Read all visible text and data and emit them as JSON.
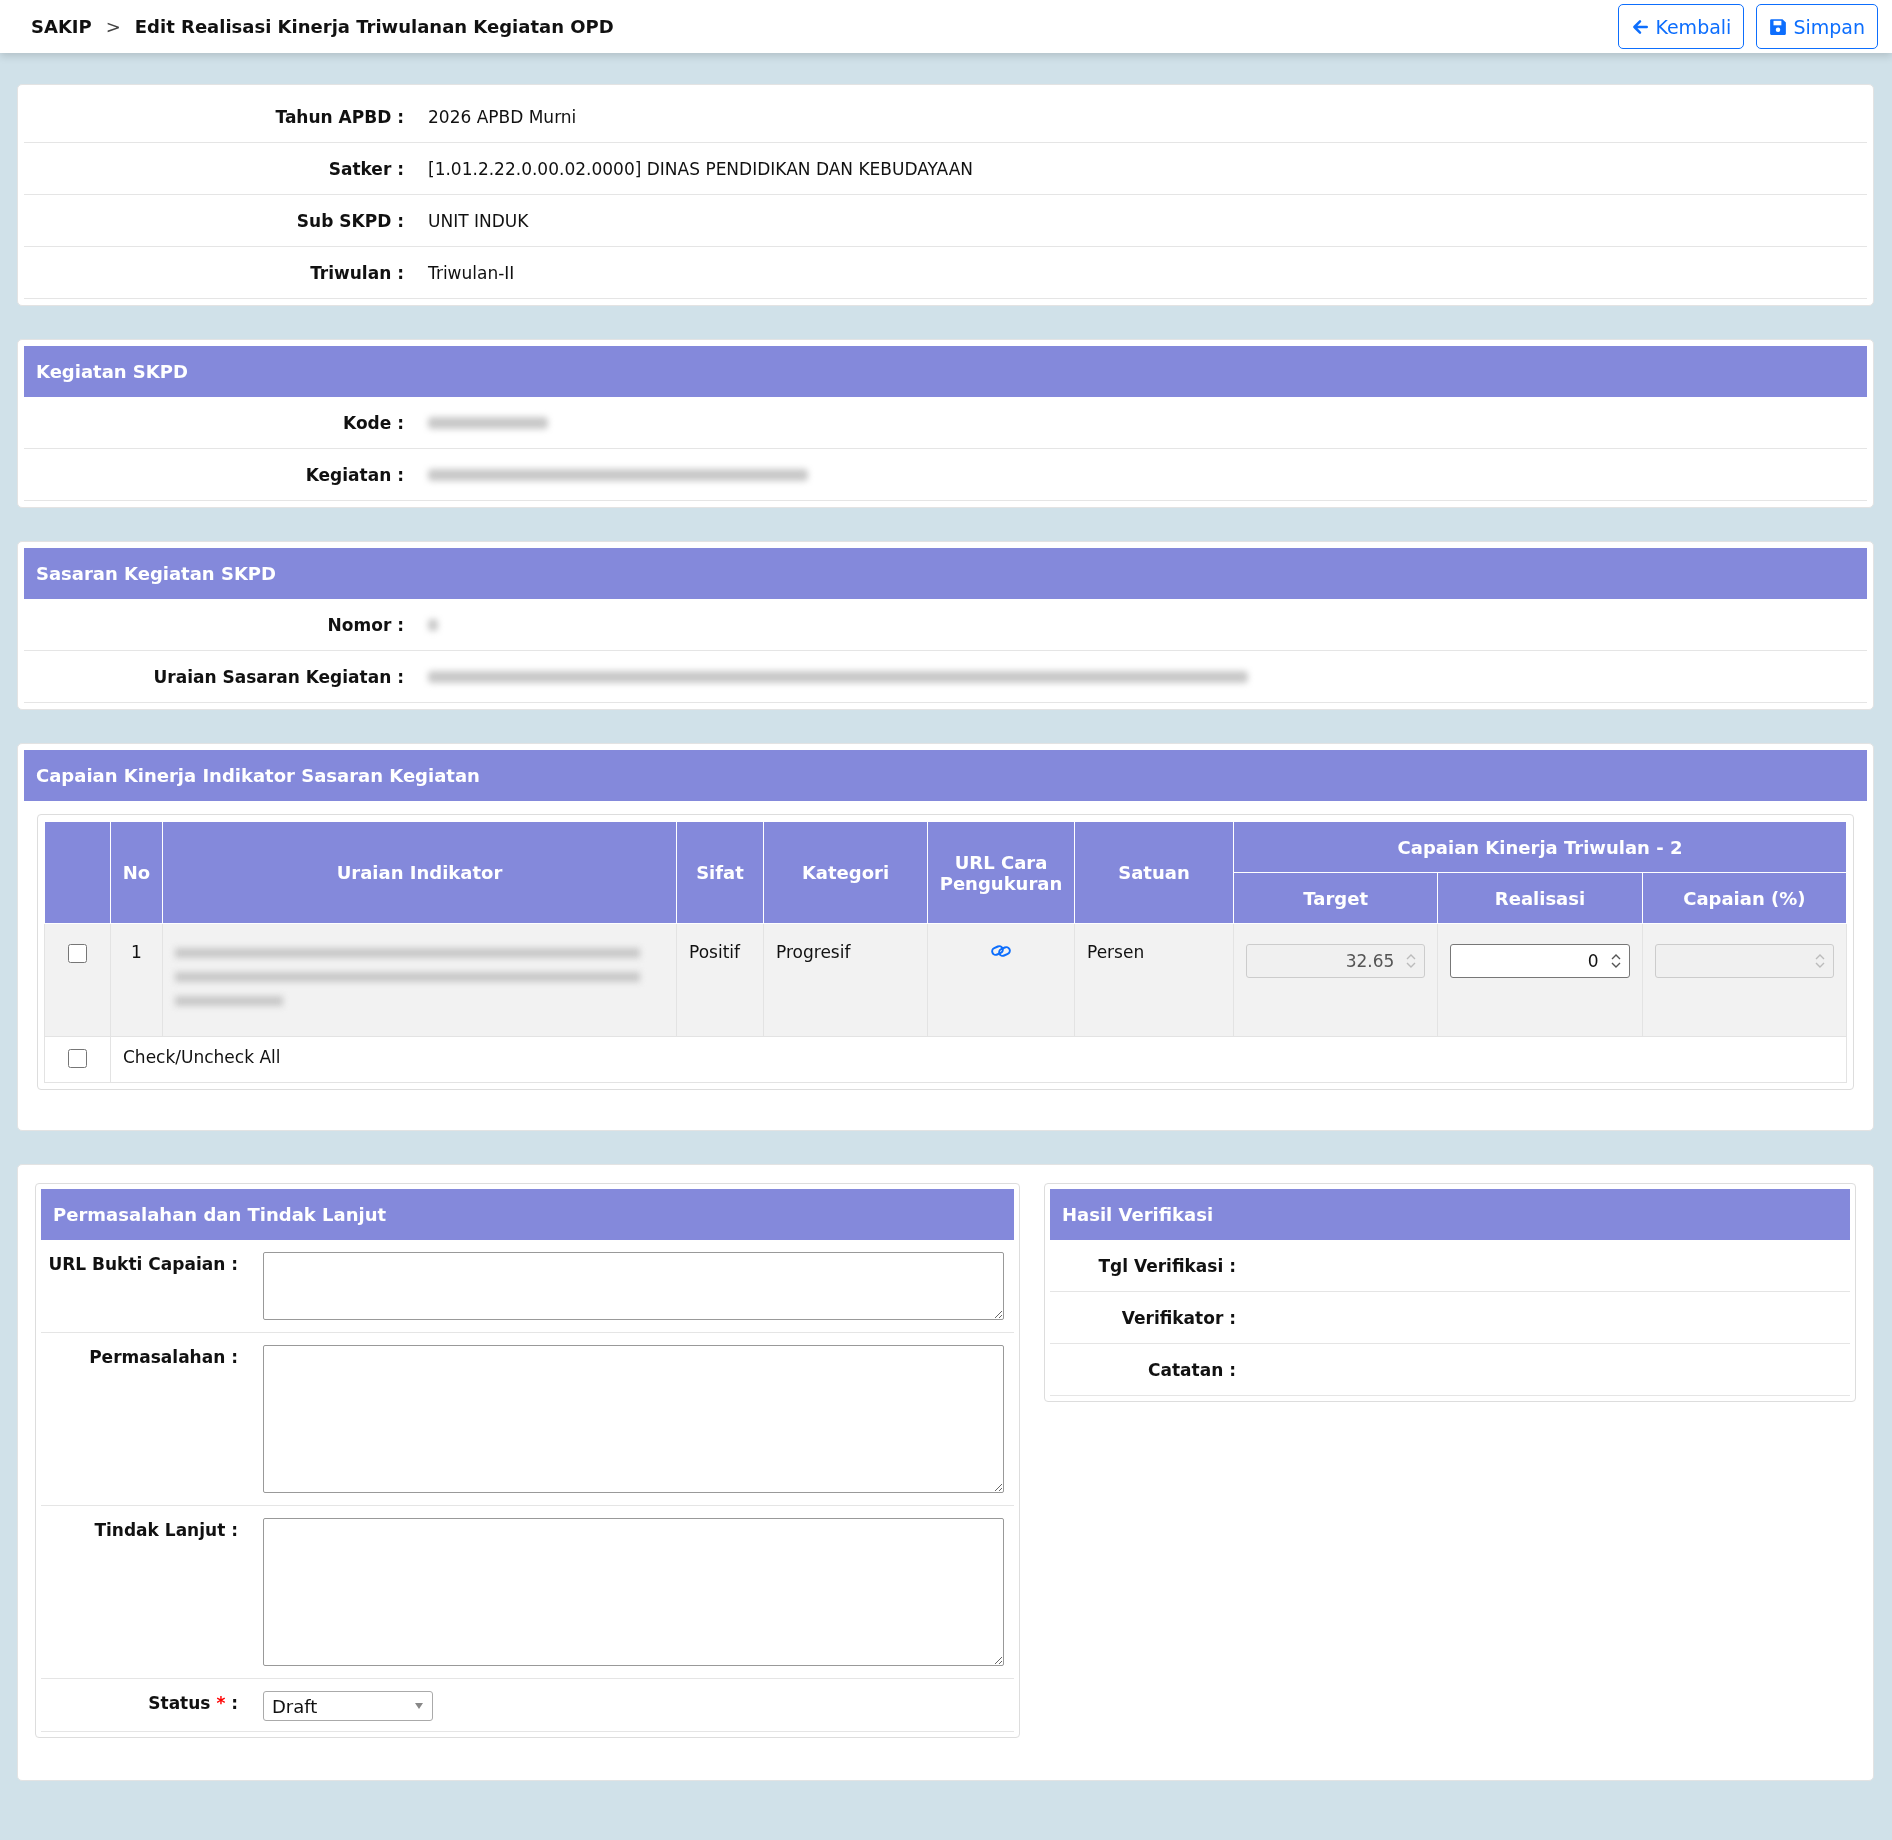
{
  "breadcrumb": {
    "root": "SAKIP",
    "separator": ">",
    "title": "Edit Realisasi Kinerja Triwulanan Kegiatan OPD"
  },
  "actions": [
    {
      "label": "Kembali",
      "kind": "back"
    },
    {
      "label": "Simpan",
      "kind": "save"
    }
  ],
  "info": [
    {
      "label": "Tahun APBD :",
      "value": "2026 APBD Murni"
    },
    {
      "label": "Satker :",
      "value": "[1.01.2.22.0.00.02.0000] DINAS PENDIDIKAN DAN KEBUDAYAAN"
    },
    {
      "label": "Sub SKPD :",
      "value": "UNIT INDUK"
    },
    {
      "label": "Triwulan :",
      "value": "Triwulan-II"
    }
  ],
  "kegiatan": {
    "title": "Kegiatan SKPD",
    "rows": [
      {
        "label": "Kode :",
        "blurred": true
      },
      {
        "label": "Kegiatan :",
        "blurred": true
      }
    ]
  },
  "sasaran": {
    "title": "Sasaran Kegiatan SKPD",
    "rows": [
      {
        "label": "Nomor :",
        "blurred": true
      },
      {
        "label": "Uraian Sasaran Kegiatan :",
        "blurred": true
      }
    ]
  },
  "capaian": {
    "title": "Capaian Kinerja Indikator Sasaran Kegiatan",
    "columns": [
      "No",
      "Uraian Indikator",
      "Sifat",
      "Kategori",
      "URL Cara Pengukuran",
      "Satuan"
    ],
    "group": "Capaian Kinerja Triwulan - 2",
    "subcolumns": [
      "Target",
      "Realisasi",
      "Capaian (%)"
    ],
    "rows": [
      {
        "checked": false,
        "no": "1",
        "uraian_blurred": true,
        "sifat": "Positif",
        "kategori": "Progresif",
        "has_link": true,
        "satuan": "Persen",
        "inputs": [
          {
            "value": "32.65",
            "disabled": true
          },
          {
            "value": "0",
            "disabled": false
          },
          {
            "disabled": true
          }
        ]
      }
    ],
    "check_all": {
      "label": "Check/Uncheck All",
      "checked": false
    }
  },
  "permasalahan": {
    "title": "Permasalahan dan Tindak Lanjut",
    "fields": [
      {
        "label": "URL Bukti Capaian :"
      },
      {
        "label": "Permasalahan :"
      },
      {
        "label": "Tindak Lanjut :"
      }
    ],
    "status": {
      "label": "Status",
      "required_mark": "*",
      "colon": ":",
      "value": "Draft"
    }
  },
  "verifikasi": {
    "title": "Hasil Verifikasi",
    "rows": [
      {
        "label": "Tgl Verifikasi :"
      },
      {
        "label": "Verifikator :"
      },
      {
        "label": "Catatan :"
      }
    ]
  }
}
